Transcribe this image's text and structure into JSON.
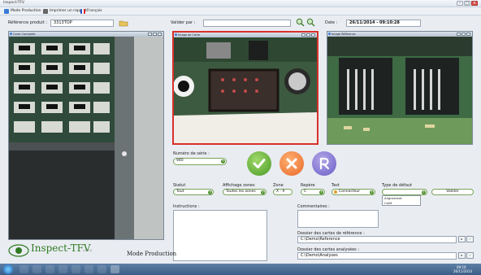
{
  "window": {
    "title": "Inspect-TFV"
  },
  "menu": [
    {
      "label": "Mode Production",
      "icon": "production-icon",
      "color": "#3a7bd5"
    },
    {
      "label": "Imprimer un rapport",
      "icon": "printer-icon",
      "color": "#555555"
    },
    {
      "label": "Français",
      "icon": "flag-icon",
      "color": "#2a56c6"
    }
  ],
  "header": {
    "reference_label": "Référence produit :",
    "reference_value": "3313TOP",
    "validate_label": "Valider par :",
    "validate_value": "",
    "date_label": "Date :",
    "date_value": "26/11/2014 - 09:10:28"
  },
  "cameras": {
    "left_title": "Carte Complete",
    "center_title": "Image de Carte",
    "right_title": "Image Référence"
  },
  "serial": {
    "label": "Numéro de série :",
    "value": "940"
  },
  "actions": {
    "ok_icon": "check-icon",
    "reject_icon": "cross-icon",
    "reset_icon": "r-logo-icon"
  },
  "filters": {
    "statut": {
      "label": "Statut",
      "value": "Tout"
    },
    "affichage": {
      "label": "Affichage zones",
      "value": "Toutes les zones"
    },
    "zone": {
      "label": "Zone",
      "value": "X · X"
    },
    "repere": {
      "label": "Repère",
      "value": "C"
    },
    "test": {
      "label": "Test",
      "value": "Connecteur"
    },
    "defaut": {
      "label": "Type de défaut",
      "value": "",
      "options": [
        "Alignement",
        "Collé"
      ]
    },
    "valider_label": "Valider"
  },
  "instructions": {
    "label": "Instructions :"
  },
  "comments": {
    "label": "Commentaires :"
  },
  "paths": {
    "reference_label": "Dossier des cartes de référence :",
    "reference_value": "C:\\Demo\\Reference",
    "analysed_label": "Dossier des cartes analysées :",
    "analysed_value": "C:\\Demo\\Analyses"
  },
  "branding": {
    "logo_text": "Inspect-TFV",
    "version": "v1.0.0",
    "mode": "Mode Production"
  },
  "taskbar": {
    "time": "09:10",
    "date": "26/11/2014"
  }
}
